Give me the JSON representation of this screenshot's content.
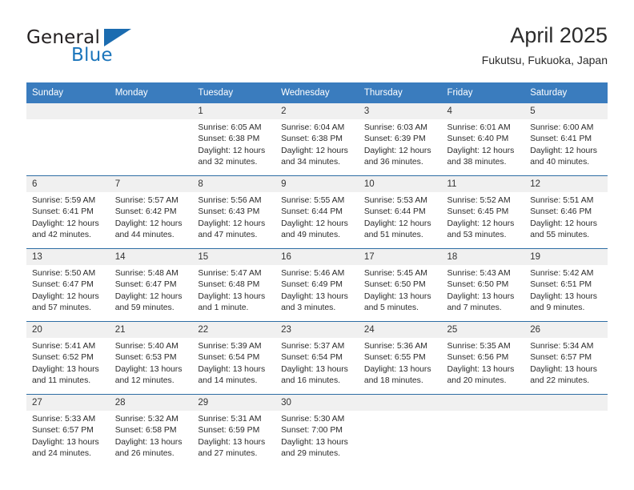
{
  "brand": {
    "line1": "General",
    "line2": "Blue",
    "triangle_color": "#1b6cb0"
  },
  "header": {
    "title": "April 2025",
    "subtitle": "Fukutsu, Fukuoka, Japan"
  },
  "colors": {
    "header_blue": "#3a7cbe",
    "row_divider": "#2e6da4",
    "daynum_band": "#f0f0f0",
    "brand_blue": "#1b75bb"
  },
  "weekdays": [
    "Sunday",
    "Monday",
    "Tuesday",
    "Wednesday",
    "Thursday",
    "Friday",
    "Saturday"
  ],
  "labels": {
    "sunrise_prefix": "Sunrise:",
    "sunset_prefix": "Sunset:",
    "daylight_prefix": "Daylight:"
  },
  "weeks": [
    [
      {
        "day": "",
        "empty": true
      },
      {
        "day": "",
        "empty": true
      },
      {
        "day": "1",
        "sunrise": "Sunrise: 6:05 AM",
        "sunset": "Sunset: 6:38 PM",
        "daylight_l1": "Daylight: 12 hours",
        "daylight_l2": "and 32 minutes."
      },
      {
        "day": "2",
        "sunrise": "Sunrise: 6:04 AM",
        "sunset": "Sunset: 6:38 PM",
        "daylight_l1": "Daylight: 12 hours",
        "daylight_l2": "and 34 minutes."
      },
      {
        "day": "3",
        "sunrise": "Sunrise: 6:03 AM",
        "sunset": "Sunset: 6:39 PM",
        "daylight_l1": "Daylight: 12 hours",
        "daylight_l2": "and 36 minutes."
      },
      {
        "day": "4",
        "sunrise": "Sunrise: 6:01 AM",
        "sunset": "Sunset: 6:40 PM",
        "daylight_l1": "Daylight: 12 hours",
        "daylight_l2": "and 38 minutes."
      },
      {
        "day": "5",
        "sunrise": "Sunrise: 6:00 AM",
        "sunset": "Sunset: 6:41 PM",
        "daylight_l1": "Daylight: 12 hours",
        "daylight_l2": "and 40 minutes."
      }
    ],
    [
      {
        "day": "6",
        "sunrise": "Sunrise: 5:59 AM",
        "sunset": "Sunset: 6:41 PM",
        "daylight_l1": "Daylight: 12 hours",
        "daylight_l2": "and 42 minutes."
      },
      {
        "day": "7",
        "sunrise": "Sunrise: 5:57 AM",
        "sunset": "Sunset: 6:42 PM",
        "daylight_l1": "Daylight: 12 hours",
        "daylight_l2": "and 44 minutes."
      },
      {
        "day": "8",
        "sunrise": "Sunrise: 5:56 AM",
        "sunset": "Sunset: 6:43 PM",
        "daylight_l1": "Daylight: 12 hours",
        "daylight_l2": "and 47 minutes."
      },
      {
        "day": "9",
        "sunrise": "Sunrise: 5:55 AM",
        "sunset": "Sunset: 6:44 PM",
        "daylight_l1": "Daylight: 12 hours",
        "daylight_l2": "and 49 minutes."
      },
      {
        "day": "10",
        "sunrise": "Sunrise: 5:53 AM",
        "sunset": "Sunset: 6:44 PM",
        "daylight_l1": "Daylight: 12 hours",
        "daylight_l2": "and 51 minutes."
      },
      {
        "day": "11",
        "sunrise": "Sunrise: 5:52 AM",
        "sunset": "Sunset: 6:45 PM",
        "daylight_l1": "Daylight: 12 hours",
        "daylight_l2": "and 53 minutes."
      },
      {
        "day": "12",
        "sunrise": "Sunrise: 5:51 AM",
        "sunset": "Sunset: 6:46 PM",
        "daylight_l1": "Daylight: 12 hours",
        "daylight_l2": "and 55 minutes."
      }
    ],
    [
      {
        "day": "13",
        "sunrise": "Sunrise: 5:50 AM",
        "sunset": "Sunset: 6:47 PM",
        "daylight_l1": "Daylight: 12 hours",
        "daylight_l2": "and 57 minutes."
      },
      {
        "day": "14",
        "sunrise": "Sunrise: 5:48 AM",
        "sunset": "Sunset: 6:47 PM",
        "daylight_l1": "Daylight: 12 hours",
        "daylight_l2": "and 59 minutes."
      },
      {
        "day": "15",
        "sunrise": "Sunrise: 5:47 AM",
        "sunset": "Sunset: 6:48 PM",
        "daylight_l1": "Daylight: 13 hours",
        "daylight_l2": "and 1 minute."
      },
      {
        "day": "16",
        "sunrise": "Sunrise: 5:46 AM",
        "sunset": "Sunset: 6:49 PM",
        "daylight_l1": "Daylight: 13 hours",
        "daylight_l2": "and 3 minutes."
      },
      {
        "day": "17",
        "sunrise": "Sunrise: 5:45 AM",
        "sunset": "Sunset: 6:50 PM",
        "daylight_l1": "Daylight: 13 hours",
        "daylight_l2": "and 5 minutes."
      },
      {
        "day": "18",
        "sunrise": "Sunrise: 5:43 AM",
        "sunset": "Sunset: 6:50 PM",
        "daylight_l1": "Daylight: 13 hours",
        "daylight_l2": "and 7 minutes."
      },
      {
        "day": "19",
        "sunrise": "Sunrise: 5:42 AM",
        "sunset": "Sunset: 6:51 PM",
        "daylight_l1": "Daylight: 13 hours",
        "daylight_l2": "and 9 minutes."
      }
    ],
    [
      {
        "day": "20",
        "sunrise": "Sunrise: 5:41 AM",
        "sunset": "Sunset: 6:52 PM",
        "daylight_l1": "Daylight: 13 hours",
        "daylight_l2": "and 11 minutes."
      },
      {
        "day": "21",
        "sunrise": "Sunrise: 5:40 AM",
        "sunset": "Sunset: 6:53 PM",
        "daylight_l1": "Daylight: 13 hours",
        "daylight_l2": "and 12 minutes."
      },
      {
        "day": "22",
        "sunrise": "Sunrise: 5:39 AM",
        "sunset": "Sunset: 6:54 PM",
        "daylight_l1": "Daylight: 13 hours",
        "daylight_l2": "and 14 minutes."
      },
      {
        "day": "23",
        "sunrise": "Sunrise: 5:37 AM",
        "sunset": "Sunset: 6:54 PM",
        "daylight_l1": "Daylight: 13 hours",
        "daylight_l2": "and 16 minutes."
      },
      {
        "day": "24",
        "sunrise": "Sunrise: 5:36 AM",
        "sunset": "Sunset: 6:55 PM",
        "daylight_l1": "Daylight: 13 hours",
        "daylight_l2": "and 18 minutes."
      },
      {
        "day": "25",
        "sunrise": "Sunrise: 5:35 AM",
        "sunset": "Sunset: 6:56 PM",
        "daylight_l1": "Daylight: 13 hours",
        "daylight_l2": "and 20 minutes."
      },
      {
        "day": "26",
        "sunrise": "Sunrise: 5:34 AM",
        "sunset": "Sunset: 6:57 PM",
        "daylight_l1": "Daylight: 13 hours",
        "daylight_l2": "and 22 minutes."
      }
    ],
    [
      {
        "day": "27",
        "sunrise": "Sunrise: 5:33 AM",
        "sunset": "Sunset: 6:57 PM",
        "daylight_l1": "Daylight: 13 hours",
        "daylight_l2": "and 24 minutes."
      },
      {
        "day": "28",
        "sunrise": "Sunrise: 5:32 AM",
        "sunset": "Sunset: 6:58 PM",
        "daylight_l1": "Daylight: 13 hours",
        "daylight_l2": "and 26 minutes."
      },
      {
        "day": "29",
        "sunrise": "Sunrise: 5:31 AM",
        "sunset": "Sunset: 6:59 PM",
        "daylight_l1": "Daylight: 13 hours",
        "daylight_l2": "and 27 minutes."
      },
      {
        "day": "30",
        "sunrise": "Sunrise: 5:30 AM",
        "sunset": "Sunset: 7:00 PM",
        "daylight_l1": "Daylight: 13 hours",
        "daylight_l2": "and 29 minutes."
      },
      {
        "day": "",
        "empty": true
      },
      {
        "day": "",
        "empty": true
      },
      {
        "day": "",
        "empty": true
      }
    ]
  ]
}
